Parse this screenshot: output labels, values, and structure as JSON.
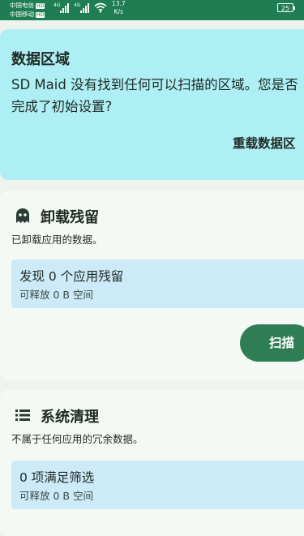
{
  "status_bar": {
    "carrier1": "中国电信",
    "carrier2": "中国移动",
    "hd": "HD",
    "net1": "4G",
    "net2": "4G",
    "speed_value": "13.7",
    "speed_unit": "K/s",
    "battery": "25",
    "icons": [
      "signal-icon",
      "signal-icon",
      "wifi-icon",
      "battery-icon"
    ]
  },
  "data_areas": {
    "title": "数据区域",
    "message": "SD Maid 没有找到任何可以扫描的区域。您是否完成了初始设置?",
    "reload_label": "重载数据区"
  },
  "corpse_finder": {
    "icon": "ghost-icon",
    "title": "卸载残留",
    "description": "已卸载应用的数据。",
    "result_main": "发现 0 个应用残留",
    "result_sub": "可释放 0 B 空间",
    "scan_label": "扫描"
  },
  "system_cleaner": {
    "icon": "list-icon",
    "title": "系统清理",
    "description": "不属于任何应用的冗余数据。",
    "result_main": "0 项满足筛选",
    "result_sub": "可释放 0 B 空间"
  },
  "colors": {
    "status_bar": "#1e7d52",
    "data_card": "#aeeef5",
    "result_box": "#cdeaf9",
    "button": "#2e7d55"
  }
}
